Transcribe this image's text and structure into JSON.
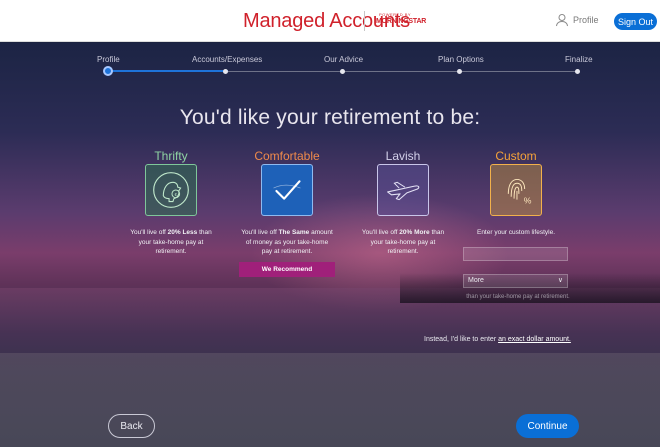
{
  "header": {
    "title": "Managed Accounts",
    "powered_by": "POWERED BY",
    "brand": "MORNINGSTAR",
    "profile_label": "Profile",
    "sign_out": "Sign Out",
    "brand_color": "#d0212b"
  },
  "steps": [
    {
      "label": "Profile",
      "state": "current"
    },
    {
      "label": "Accounts/Expenses",
      "state": "upcoming"
    },
    {
      "label": "Our Advice",
      "state": "upcoming"
    },
    {
      "label": "Plan Options",
      "state": "upcoming"
    },
    {
      "label": "Finalize",
      "state": "upcoming"
    }
  ],
  "heading": "You'd like your retirement to be:",
  "options": [
    {
      "name": "Thrifty",
      "icon": "piggy-coin-icon",
      "desc_pre": "You'll live off ",
      "desc_bold": "20% Less",
      "desc_post": " than your take-home pay at retirement.",
      "color": "#8fd4a3"
    },
    {
      "name": "Comfortable",
      "icon": "checkmark-icon",
      "selected": true,
      "desc_pre": "You'll live off ",
      "desc_bold": "The Same",
      "desc_post": " amount of money as your take-home pay at retirement.",
      "color": "#f08a4b"
    },
    {
      "name": "Lavish",
      "icon": "airplane-icon",
      "desc_pre": "You'll live off ",
      "desc_bold": "20% More",
      "desc_post": " than your take-home pay at retirement.",
      "color": "#d3d0ea"
    },
    {
      "name": "Custom",
      "icon": "fingerprint-percent-icon",
      "desc": "Enter your custom lifestyle.",
      "color": "#f5a23a"
    }
  ],
  "recommend": "We Recommend",
  "custom": {
    "input_placeholder": "",
    "select_value": "More",
    "help": "than your take-home pay at retirement."
  },
  "exact": {
    "prefix": "Instead, I'd like to enter ",
    "link": "an exact dollar amount."
  },
  "buttons": {
    "back": "Back",
    "continue": "Continue",
    "accent": "#0a6fd6"
  }
}
